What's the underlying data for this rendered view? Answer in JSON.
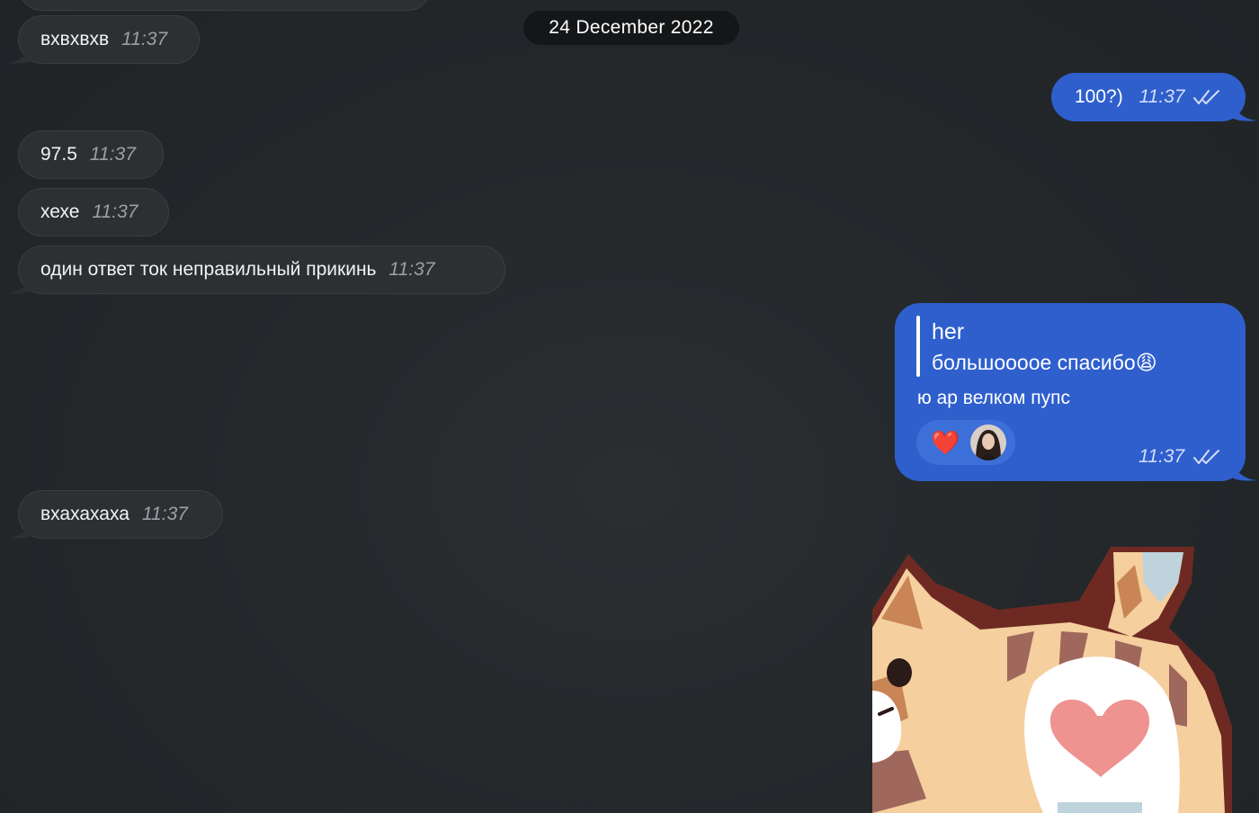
{
  "date_separator": "24 December 2022",
  "incoming": [
    {
      "text": "вхвхвхв",
      "time": "11:37"
    },
    {
      "text": "97.5",
      "time": "11:37"
    },
    {
      "text": "хехе",
      "time": "11:37"
    },
    {
      "text": "один ответ ток неправильный прикинь",
      "time": "11:37"
    },
    {
      "text": "вхахахаха",
      "time": "11:37"
    }
  ],
  "outgoing": [
    {
      "text": "100?)",
      "time": "11:37",
      "status": "read"
    }
  ],
  "reply_message": {
    "quote_author": "her",
    "quote_text": "большоооое спасибо",
    "quote_emoji": "😩",
    "text": "ю ар велком пупс",
    "time": "11:37",
    "status": "read",
    "reaction": "❤️"
  },
  "colors": {
    "background": "#24282b",
    "incoming_bubble": "#2d3033",
    "outgoing_bubble": "#2f5fcc",
    "date_pill": "#141618"
  },
  "icons": {
    "read_status": "double-check-icon",
    "reaction_avatar": "avatar",
    "sticker": "cat-heart-sticker"
  }
}
